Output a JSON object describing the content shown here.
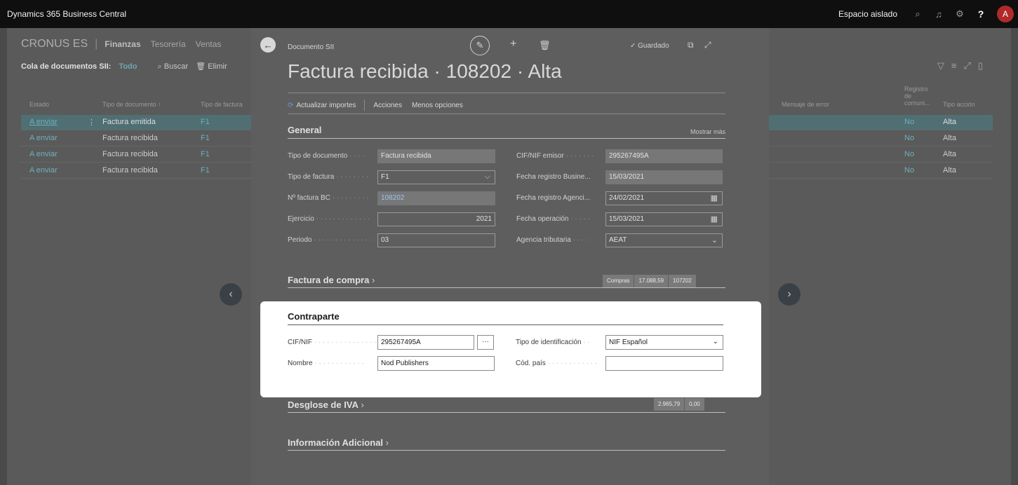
{
  "appbar": {
    "app_name": "Dynamics 365 Business Central",
    "environment": "Espacio aislado",
    "help": "?",
    "avatar": "A",
    "icons": [
      "search-icon",
      "bell-icon",
      "gear-icon"
    ]
  },
  "bg": {
    "company": "CRONUS ES",
    "nav": [
      "Finanzas",
      "Tesorería",
      "Ventas"
    ],
    "list_title": "Cola de documentos SII:",
    "filter": "Todo",
    "search": "Buscar",
    "delete": "Elimir",
    "columns": {
      "estado": "Estado",
      "tipo_doc": "Tipo de documento ↑",
      "tipo_factura": "Tipo de factura",
      "mensaje": "Mensaje de error",
      "registro": "Registro de comuni...",
      "tipo_accion": "Tipo acción"
    },
    "rows": [
      {
        "estado": "A enviar",
        "tipo": "Factura emitida",
        "factura": "F1",
        "registro": "No",
        "accion": "Alta"
      },
      {
        "estado": "A enviar",
        "tipo": "Factura recibida",
        "factura": "F1",
        "registro": "No",
        "accion": "Alta"
      },
      {
        "estado": "A enviar",
        "tipo": "Factura recibida",
        "factura": "F1",
        "registro": "No",
        "accion": "Alta"
      },
      {
        "estado": "A enviar",
        "tipo": "Factura recibida",
        "factura": "F1",
        "registro": "No",
        "accion": "Alta"
      }
    ]
  },
  "card": {
    "breadcrumb": "Documento SII",
    "title": "Factura recibida · 108202 · Alta",
    "saved": "✓ Guardado",
    "actions": {
      "refresh": "Actualizar importes",
      "acciones": "Acciones",
      "menos": "Menos opciones"
    },
    "general": {
      "title": "General",
      "show_more": "Mostrar más",
      "tipo_documento_label": "Tipo de documento",
      "tipo_documento": "Factura recibida",
      "tipo_factura_label": "Tipo de factura",
      "tipo_factura": "F1",
      "n_factura_label": "Nº factura BC",
      "n_factura": "108202",
      "ejercicio_label": "Ejercicio",
      "ejercicio": "2021",
      "periodo_label": "Periodo",
      "periodo": "03",
      "cif_emisor_label": "CIF/NIF emisor",
      "cif_emisor": "295267495A",
      "fecha_bus_label": "Fecha registro Busine...",
      "fecha_bus": "15/03/2021",
      "fecha_agencia_label": "Fecha registro Agenci...",
      "fecha_agencia": "24/02/2021",
      "fecha_op_label": "Fecha operación",
      "fecha_op": "15/03/2021",
      "agencia_label": "Agencia tributaria",
      "agencia": "AEAT"
    },
    "factura_compra": {
      "title": "Factura de compra",
      "totals": [
        "Compras",
        "17.088,59",
        "107202"
      ]
    },
    "contraparte": {
      "title": "Contraparte",
      "cif_label": "CIF/NIF",
      "cif": "295267495A",
      "ellipsis": "···",
      "nombre_label": "Nombre",
      "nombre": "Nod Publishers",
      "tipo_id_label": "Tipo de identificación",
      "tipo_id": "NIF Español",
      "cod_pais_label": "Cód. país",
      "cod_pais": ""
    },
    "desglose": {
      "title": "Desglose de IVA",
      "totals": [
        "2.965,79",
        "0,00"
      ]
    },
    "info": {
      "title": "Información Adicional"
    }
  }
}
